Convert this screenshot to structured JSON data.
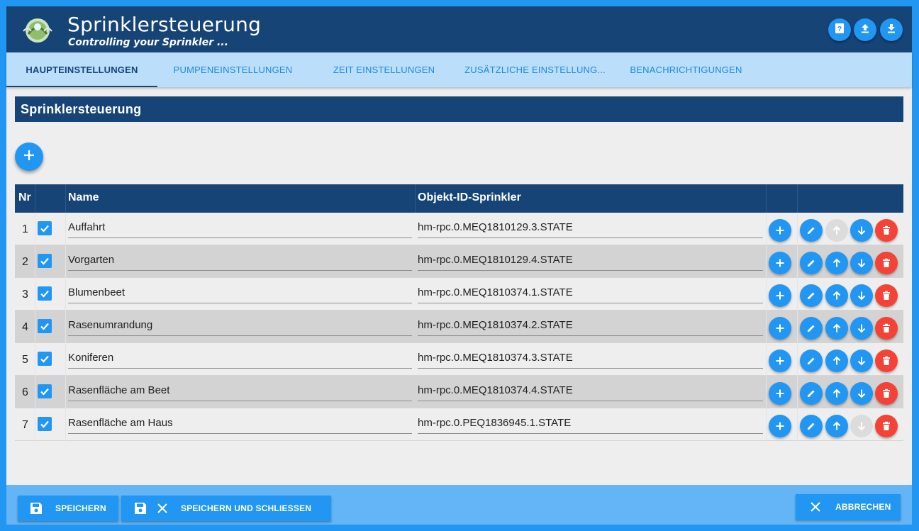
{
  "header": {
    "title": "Sprinklersteuerung",
    "subtitle": "Controlling your Sprinkler ...",
    "icons": [
      "help-icon",
      "upload-icon",
      "download-icon"
    ]
  },
  "tabs": [
    {
      "label": "Haupteinstellungen",
      "active": true
    },
    {
      "label": "Pumpeneinstellungen",
      "active": false
    },
    {
      "label": "Zeit Einstellungen",
      "active": false
    },
    {
      "label": "Zusätzliche Einstellung...",
      "active": false
    },
    {
      "label": "Benachrichtigungen",
      "active": false
    }
  ],
  "section": {
    "title": "Sprinklersteuerung"
  },
  "table": {
    "headers": {
      "nr": "Nr",
      "name": "Name",
      "object_id": "Objekt-ID-Sprinkler"
    },
    "rows": [
      {
        "nr": "1",
        "checked": true,
        "name": "Auffahrt",
        "object_id": "hm-rpc.0.MEQ1810129.3.STATE",
        "up_enabled": false,
        "down_enabled": true
      },
      {
        "nr": "2",
        "checked": true,
        "name": "Vorgarten",
        "object_id": "hm-rpc.0.MEQ1810129.4.STATE",
        "up_enabled": true,
        "down_enabled": true
      },
      {
        "nr": "3",
        "checked": true,
        "name": "Blumenbeet",
        "object_id": "hm-rpc.0.MEQ1810374.1.STATE",
        "up_enabled": true,
        "down_enabled": true
      },
      {
        "nr": "4",
        "checked": true,
        "name": "Rasenumrandung",
        "object_id": "hm-rpc.0.MEQ1810374.2.STATE",
        "up_enabled": true,
        "down_enabled": true
      },
      {
        "nr": "5",
        "checked": true,
        "name": "Koniferen",
        "object_id": "hm-rpc.0.MEQ1810374.3.STATE",
        "up_enabled": true,
        "down_enabled": true
      },
      {
        "nr": "6",
        "checked": true,
        "name": "Rasenfläche am Beet",
        "object_id": "hm-rpc.0.MEQ1810374.4.STATE",
        "up_enabled": true,
        "down_enabled": true
      },
      {
        "nr": "7",
        "checked": true,
        "name": "Rasenfläche am Haus",
        "object_id": "hm-rpc.0.PEQ1836945.1.STATE",
        "up_enabled": true,
        "down_enabled": false
      }
    ]
  },
  "footer": {
    "save": "Speichern",
    "save_close": "Speichern und schliessen",
    "cancel": "Abbrechen"
  },
  "colors": {
    "primary": "#2196f3",
    "header": "#164477",
    "tabs_bg": "#bbdefb",
    "footer_bg": "#64b5f6",
    "delete": "#f44336"
  }
}
